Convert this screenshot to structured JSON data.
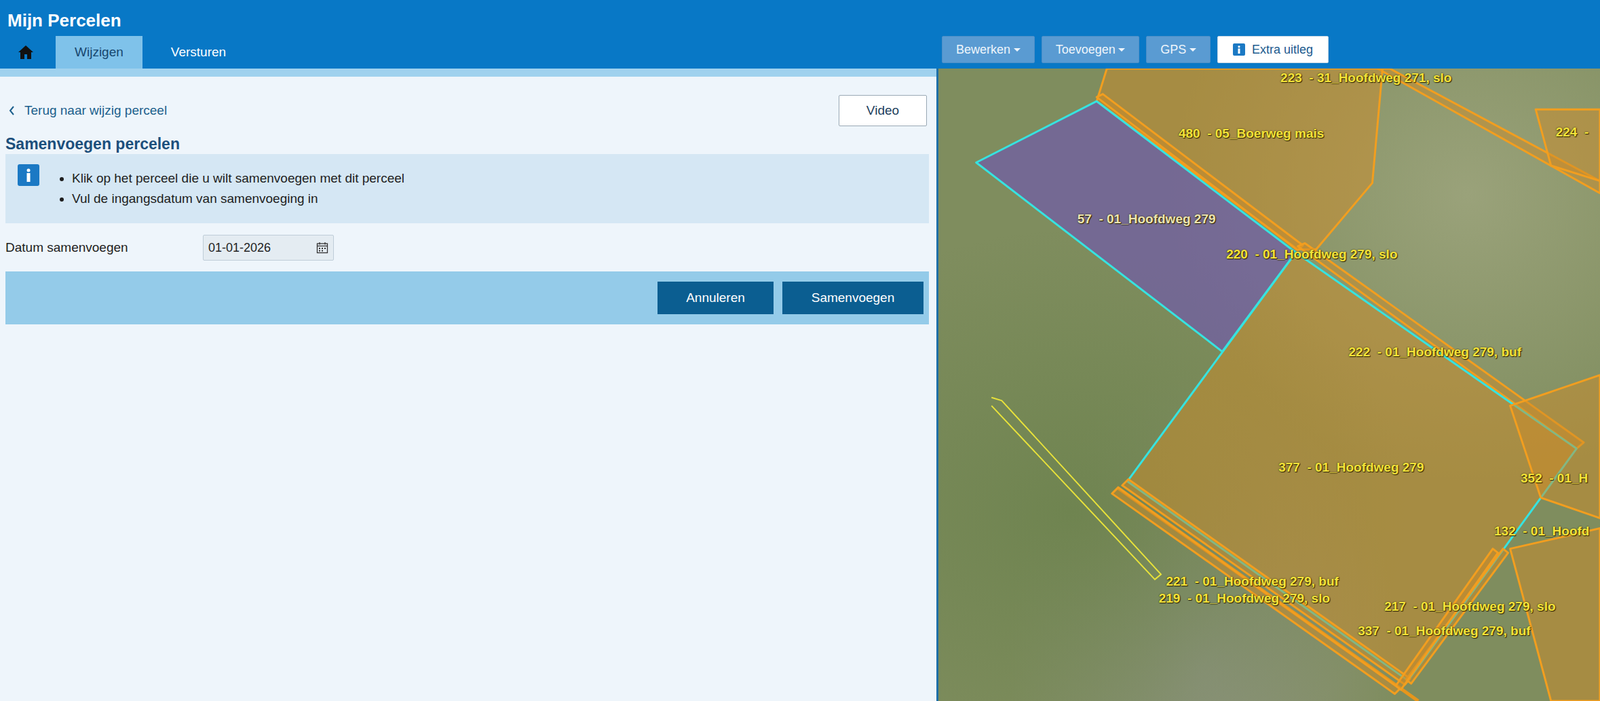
{
  "app": {
    "title": "Mijn Percelen"
  },
  "nav": {
    "home": {
      "selected": false
    },
    "tabs": [
      {
        "label": "Wijzigen",
        "selected": true
      },
      {
        "label": "Versturen",
        "selected": false
      }
    ]
  },
  "toolbar": {
    "menus": [
      "Bewerken",
      "Toevoegen",
      "GPS"
    ],
    "help_button": "Extra uitleg"
  },
  "panel": {
    "back_link": "Terug naar wijzig perceel",
    "video_button": "Video",
    "title": "Samenvoegen percelen",
    "instructions": [
      "Klik op het perceel die u wilt samenvoegen met dit perceel",
      "Vul de ingangsdatum van samenvoeging in"
    ],
    "date_field": {
      "label": "Datum samenvoegen",
      "value": "01-01-2026"
    },
    "buttons": [
      "Annuleren",
      "Samenvoegen"
    ]
  },
  "map": {
    "parcels": [
      {
        "label": "223  - 31_Hoofdweg 271, slo",
        "selected": false,
        "color": "#f29e1f"
      },
      {
        "label": "480  - 05_Boerweg mais",
        "selected": false,
        "color": "#f29e1f"
      },
      {
        "label": "224  -",
        "selected": false,
        "color": "#f29e1f"
      },
      {
        "label": "57  - 01_Hoofdweg 279",
        "selected": true,
        "color": "#36e3e0"
      },
      {
        "label": "220  - 01_Hoofdweg 279, slo",
        "selected": false,
        "color": "#f29e1f"
      },
      {
        "label": "222  - 01_Hoofdweg 279, buf",
        "selected": false,
        "color": "#f29e1f"
      },
      {
        "label": "377  - 01_Hoofdweg 279",
        "selected": false,
        "color": "#36e3e0"
      },
      {
        "label": "352  - 01_H",
        "selected": false,
        "color": "#f29e1f"
      },
      {
        "label": "132  - 01_Hoofd",
        "selected": false,
        "color": "#f29e1f"
      },
      {
        "label": "221  - 01_Hoofdweg 279, buf",
        "selected": false,
        "color": "#f29e1f"
      },
      {
        "label": "219  - 01_Hoofdweg 279, slo",
        "selected": false,
        "color": "#f29e1f"
      },
      {
        "label": "217  - 01_Hoofdweg 279, slo",
        "selected": false,
        "color": "#f29e1f"
      },
      {
        "label": "337  - 01_Hoofdweg 279, buf",
        "selected": false,
        "color": "#f29e1f"
      }
    ]
  }
}
